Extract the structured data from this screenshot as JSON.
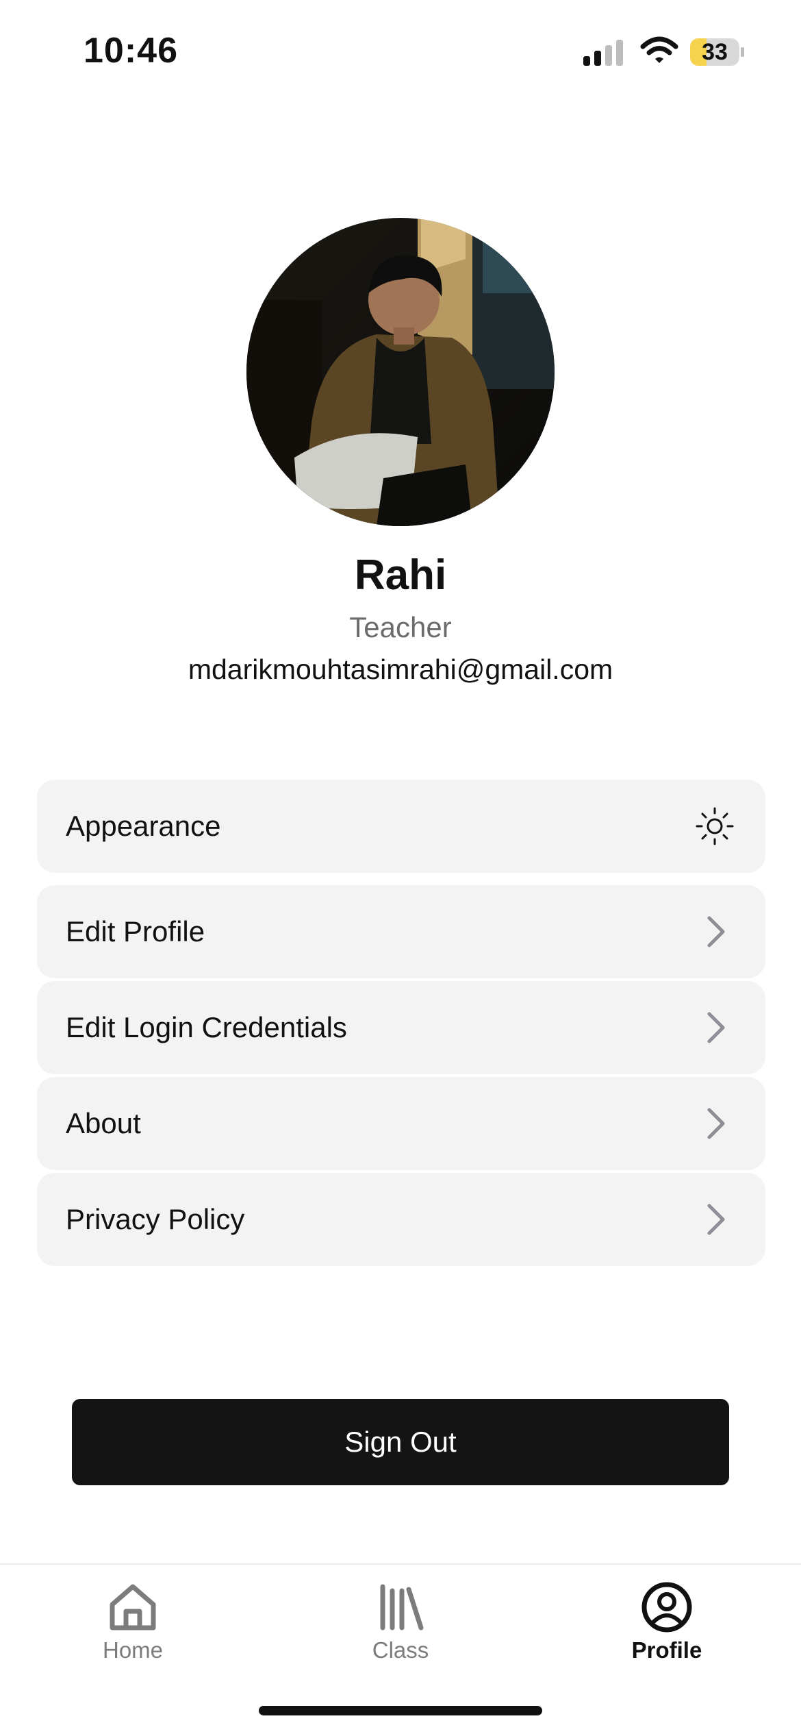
{
  "status_bar": {
    "time": "10:46",
    "battery_level": "33",
    "battery_fraction": 0.33,
    "battery_color": "#f6d34c",
    "signal_icon": "cellular-signal-icon",
    "wifi_icon": "wifi-icon"
  },
  "profile": {
    "name": "Rahi",
    "role": "Teacher",
    "email": "mdarikmouhtasimrahi@gmail.com"
  },
  "menu": [
    {
      "label": "Appearance",
      "icon": "sun-icon"
    },
    {
      "label": "Edit Profile",
      "icon": "chevron-right-icon"
    },
    {
      "label": "Edit Login Credentials",
      "icon": "chevron-right-icon"
    },
    {
      "label": "About",
      "icon": "chevron-right-icon"
    },
    {
      "label": "Privacy Policy",
      "icon": "chevron-right-icon"
    }
  ],
  "sign_out_label": "Sign Out",
  "tabs": [
    {
      "label": "Home",
      "icon": "home-icon",
      "active": false
    },
    {
      "label": "Class",
      "icon": "library-icon",
      "active": false
    },
    {
      "label": "Profile",
      "icon": "profile-icon",
      "active": true
    }
  ],
  "colors": {
    "accent": "#141414",
    "card_bg": "#f3f3f3",
    "muted_text": "#6b6b6b",
    "chevron": "#8e8e96"
  }
}
